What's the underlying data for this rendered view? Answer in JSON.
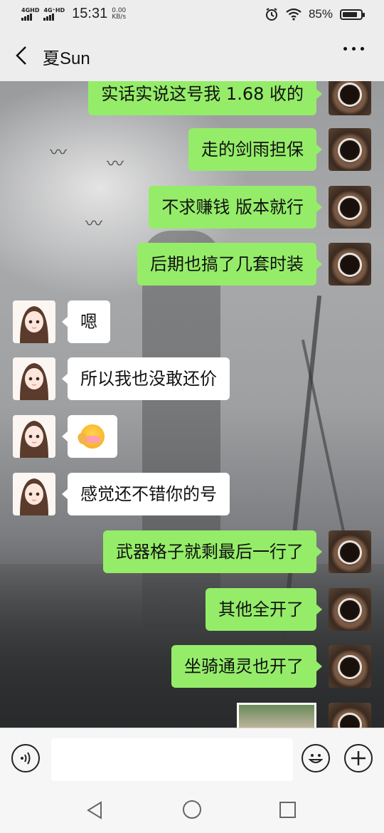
{
  "status_bar": {
    "network_1": "4GHD",
    "network_2": "4G⁺HD",
    "time": "15:31",
    "speed_value": "0.00",
    "speed_unit": "KB/s",
    "battery": "85%",
    "battery_level": 0.85
  },
  "header": {
    "title": "夏Sun",
    "back_icon": "chevron-left-icon",
    "more_icon": "more-dots-icon"
  },
  "messages": [
    {
      "sender": "me",
      "text": "实话实说这号我 1.68 收的"
    },
    {
      "sender": "me",
      "text": "走的剑雨担保"
    },
    {
      "sender": "me",
      "text": "不求赚钱  版本就行"
    },
    {
      "sender": "me",
      "text": "后期也搞了几套时装"
    },
    {
      "sender": "other",
      "text": "嗯"
    },
    {
      "sender": "other",
      "text": "所以我也没敢还价"
    },
    {
      "sender": "other",
      "type": "emoji",
      "emoji": "facepalm-emoji"
    },
    {
      "sender": "other",
      "text": "感觉还不错你的号"
    },
    {
      "sender": "me",
      "text": "武器格子就剩最后一行了"
    },
    {
      "sender": "me",
      "text": "其他全开了"
    },
    {
      "sender": "me",
      "text": "坐骑通灵也开了"
    },
    {
      "sender": "me",
      "type": "image"
    }
  ],
  "input_bar": {
    "voice_icon": "voice-icon",
    "emoji_icon": "emoji-icon",
    "plus_icon": "plus-icon",
    "text_value": ""
  },
  "nav_bar": {
    "back_icon": "triangle-back-icon",
    "home_icon": "circle-home-icon",
    "recent_icon": "square-recent-icon"
  },
  "colors": {
    "my_bubble": "#95ec69",
    "other_bubble": "#ffffff",
    "bar_bg": "#ededed"
  }
}
